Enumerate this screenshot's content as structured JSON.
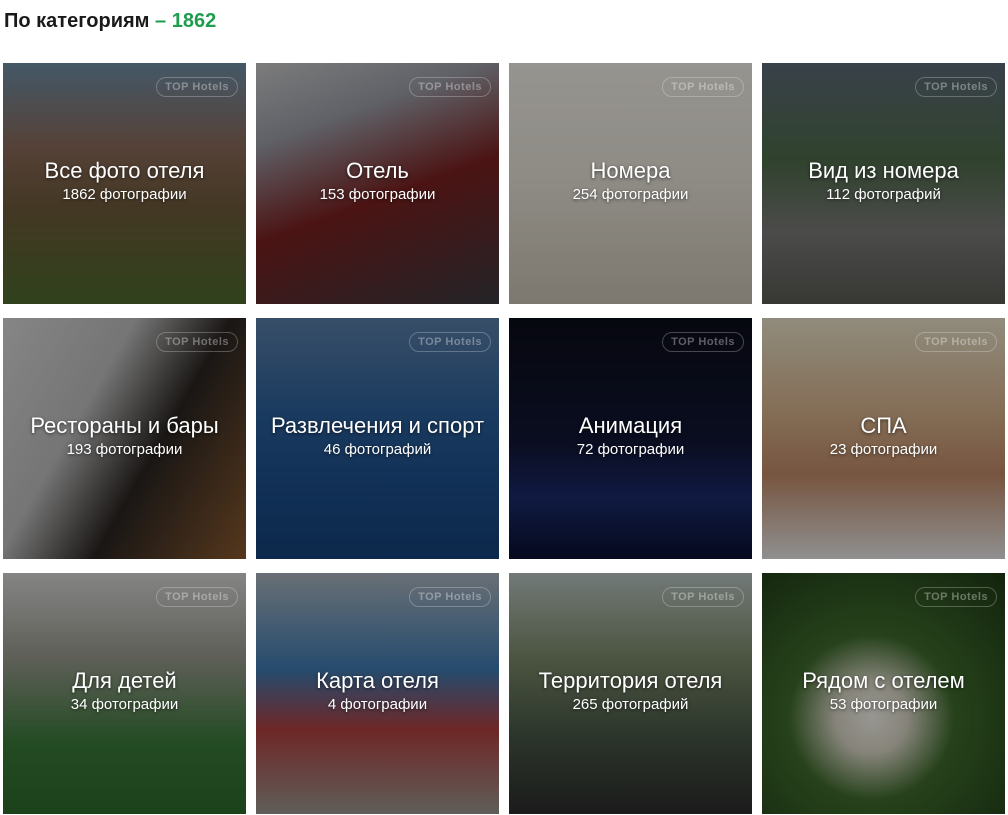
{
  "header": {
    "title": "По категориям",
    "separator": " – ",
    "total": "1862"
  },
  "watermark": "TOP Hotels",
  "categories": [
    {
      "name": "Все фото отеля",
      "count": "1862 фотографии"
    },
    {
      "name": "Отель",
      "count": "153 фотографии"
    },
    {
      "name": "Номера",
      "count": "254 фотографии"
    },
    {
      "name": "Вид из номера",
      "count": "112 фотографий"
    },
    {
      "name": "Рестораны и бары",
      "count": "193 фотографии"
    },
    {
      "name": "Развлечения и спорт",
      "count": "46 фотографий"
    },
    {
      "name": "Анимация",
      "count": "72 фотографии"
    },
    {
      "name": "СПА",
      "count": "23 фотографии"
    },
    {
      "name": "Для детей",
      "count": "34 фотографии"
    },
    {
      "name": "Карта отеля",
      "count": "4 фотографии"
    },
    {
      "name": "Территория отеля",
      "count": "265 фотографий"
    },
    {
      "name": "Рядом с отелем",
      "count": "53 фотографии"
    }
  ],
  "colors": {
    "accent": "#1f9d4e",
    "text": "#1a1a1a"
  }
}
